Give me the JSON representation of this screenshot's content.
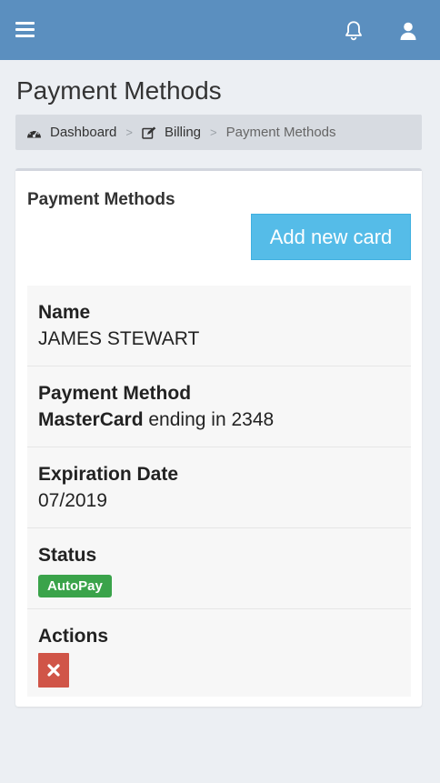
{
  "header": {
    "menu_icon": "hamburger-menu-icon",
    "notifications_icon": "bell-icon",
    "user_icon": "user-icon",
    "bar_color": "#5b8fbf"
  },
  "page": {
    "title": "Payment Methods"
  },
  "breadcrumb": {
    "items": [
      {
        "label": "Dashboard",
        "icon": "dashboard-gauge-icon"
      },
      {
        "label": "Billing",
        "icon": "edit-icon"
      },
      {
        "label": "Payment Methods"
      }
    ],
    "separator": ">"
  },
  "panel": {
    "title": "Payment Methods",
    "add_button_label": "Add new card",
    "add_button_color": "#55bce8"
  },
  "card": {
    "name_label": "Name",
    "name_value": "JAMES STEWART",
    "method_label": "Payment Method",
    "method_brand": "MasterCard",
    "method_suffix": " ending in 2348",
    "expiration_label": "Expiration Date",
    "expiration_value": "07/2019",
    "status_label": "Status",
    "status_badge": "AutoPay",
    "status_color": "#3aa34a",
    "actions_label": "Actions",
    "delete_icon": "close-x-icon",
    "delete_color": "#d05548"
  }
}
